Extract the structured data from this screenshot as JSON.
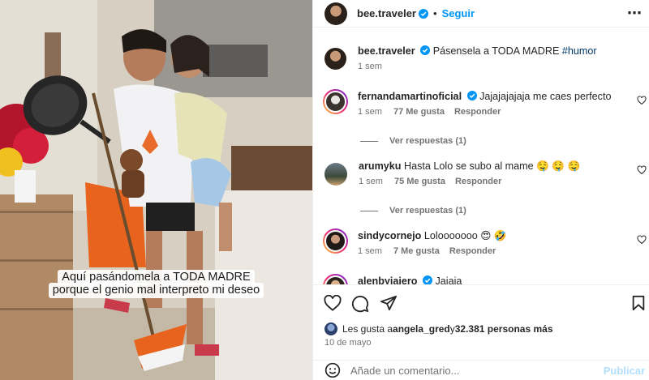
{
  "media": {
    "caption_line1": "Aquí pasándomela a TODA MADRE",
    "caption_line2": "porque el genio mal interpreto mi deseo"
  },
  "header": {
    "username": "bee.traveler",
    "separator": "•",
    "follow_label": "Seguir",
    "more_icon": "more-horizontal-icon"
  },
  "post": {
    "username": "bee.traveler",
    "text": "Pásensela a TODA MADRE ",
    "hashtag": "#humor",
    "time": "1 sem"
  },
  "comments": [
    {
      "username": "fernandamartinoficial",
      "text": "Jajajajajaja me caes perfecto",
      "time": "1 sem",
      "likes": "77 Me gusta",
      "reply_label": "Responder",
      "view_replies": "Ver respuestas (1)"
    },
    {
      "username": "arumyku",
      "text": "Hasta Lolo se subo al mame 🤤 🤤 🤤",
      "time": "1 sem",
      "likes": "75 Me gusta",
      "reply_label": "Responder",
      "view_replies": "Ver respuestas (1)"
    },
    {
      "username": "sindycornejo",
      "text": "Lolooooooo 😍 🤣",
      "time": "1 sem",
      "likes": "7 Me gusta",
      "reply_label": "Responder"
    },
    {
      "username": "alenbyiaiero",
      "text": "Jajaja"
    }
  ],
  "actions": {
    "like_icon": "heart-icon",
    "comment_icon": "comment-icon",
    "share_icon": "share-icon",
    "save_icon": "bookmark-icon"
  },
  "likes_summary": {
    "prefix": "Les gusta a ",
    "user": "angela_gred",
    "middle": " y ",
    "count": "32.381 personas más"
  },
  "date": "10 de mayo",
  "comment_input": {
    "placeholder": "Añade un comentario...",
    "post_label": "Publicar"
  },
  "colors": {
    "accent": "#0095f6",
    "hashtag": "#00376b",
    "verified": "#0095f6",
    "muted": "#737373"
  }
}
